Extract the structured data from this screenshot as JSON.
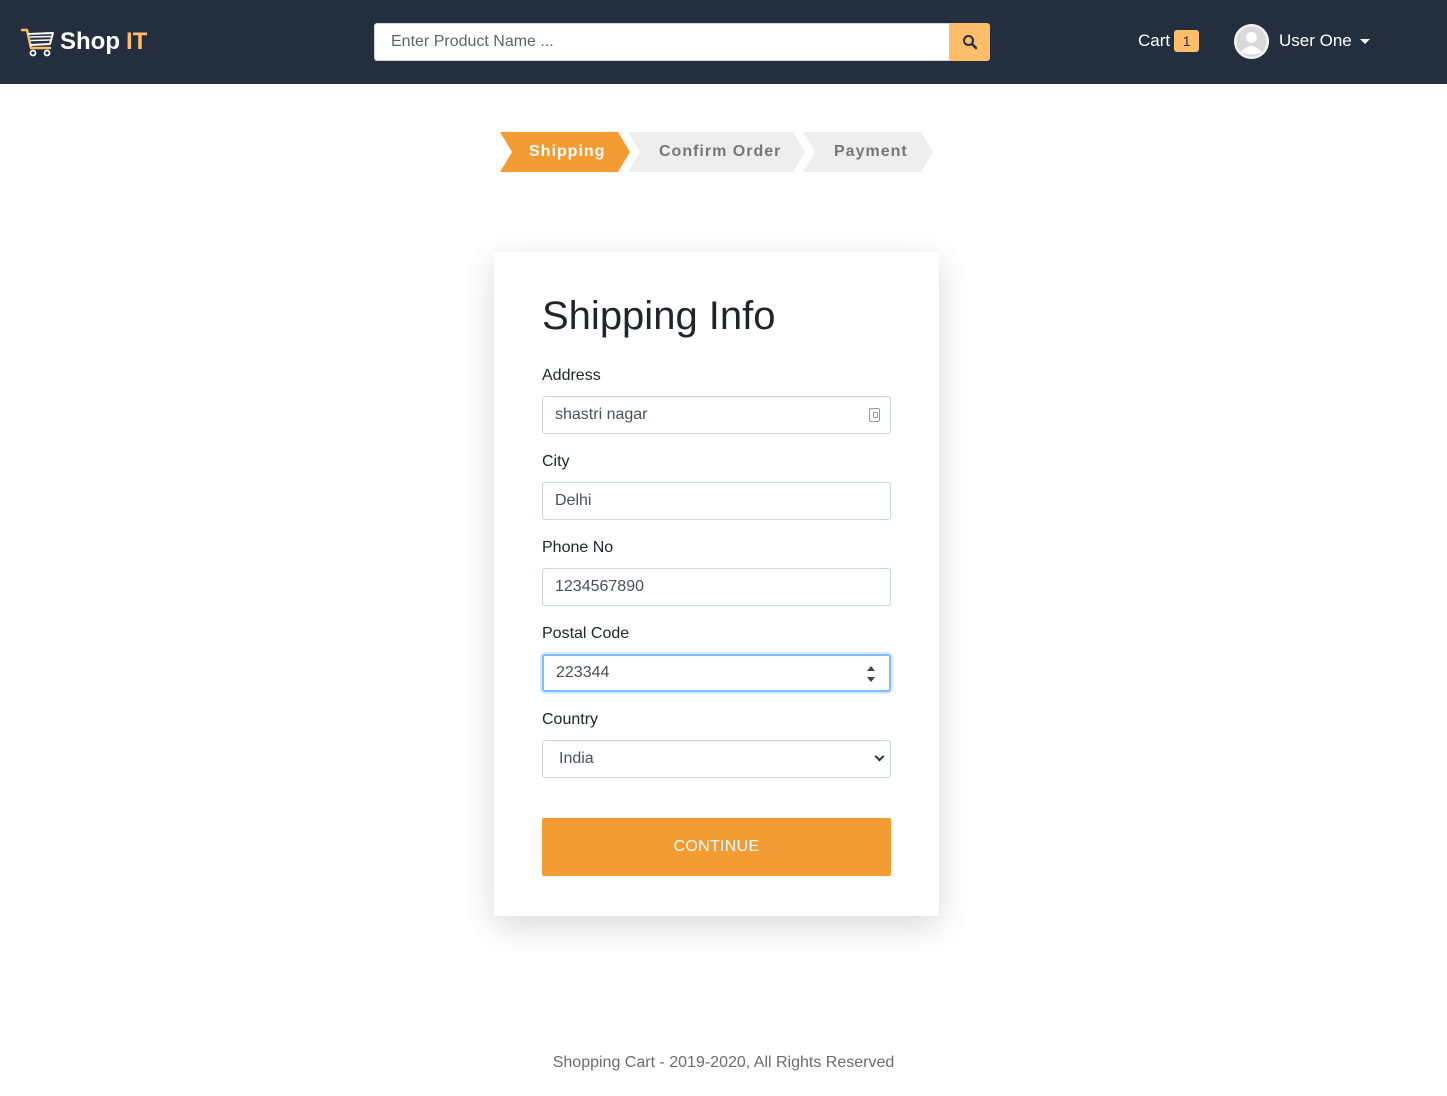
{
  "brand": {
    "shop": "Shop",
    "it": "IT"
  },
  "search": {
    "placeholder": "Enter Product Name ..."
  },
  "header": {
    "cart_label": "Cart",
    "cart_count": "1",
    "user_name": "User One"
  },
  "steps": [
    {
      "label": "Shipping",
      "state": "active"
    },
    {
      "label": "Confirm Order",
      "state": "inactive"
    },
    {
      "label": "Payment",
      "state": "inactive"
    }
  ],
  "form": {
    "title": "Shipping Info",
    "address": {
      "label": "Address",
      "value": "shastri nagar"
    },
    "city": {
      "label": "City",
      "value": "Delhi"
    },
    "phone": {
      "label": "Phone No",
      "value": "1234567890"
    },
    "postal": {
      "label": "Postal Code",
      "value": "223344"
    },
    "country": {
      "label": "Country",
      "value": "India"
    },
    "submit_label": "CONTINUE"
  },
  "footer": {
    "text": "Shopping Cart - 2019-2020, All Rights Reserved"
  },
  "colors": {
    "navbar": "#232f3e",
    "accent": "#febd69",
    "button": "#f39c33",
    "step_active": "#f39c33",
    "step_inactive": "#eeeeee"
  }
}
